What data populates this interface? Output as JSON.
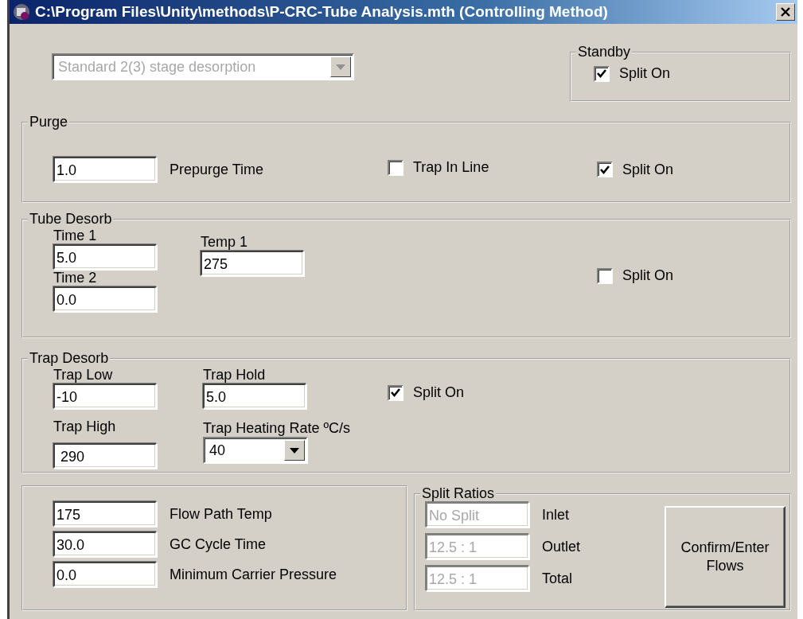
{
  "window": {
    "title": "C:\\Program Files\\Unity\\methods\\P-CRC-Tube Analysis.mth (Controlling Method)"
  },
  "method_type": {
    "value": "Standard 2(3) stage desorption",
    "disabled": true
  },
  "standby": {
    "title": "Standby",
    "checkbox": {
      "label": "Split On",
      "checked": true
    }
  },
  "purge": {
    "title": "Purge",
    "field": {
      "value": "1.0",
      "label": "Prepurge Time"
    },
    "checkboxes": [
      {
        "label": "Trap In Line",
        "checked": false
      },
      {
        "label": "Split On",
        "checked": true
      }
    ]
  },
  "tube_desorb": {
    "title": "Tube Desorb",
    "time_fields": [
      {
        "label": "Time 1",
        "value": "5.0"
      },
      {
        "label": "Time 2",
        "value": "0.0"
      }
    ],
    "temp_field": {
      "label": "Temp 1",
      "value": "275"
    },
    "checkbox": {
      "label": "Split On",
      "checked": false
    }
  },
  "trap_desorb": {
    "title": "Trap Desorb",
    "left_fields": [
      {
        "label": "Trap Low",
        "value": "-10"
      },
      {
        "label": "Trap High",
        "value": " 290"
      }
    ],
    "trap_hold": {
      "label": "Trap Hold",
      "value": "5.0"
    },
    "heating_rate": {
      "label": "Trap Heating Rate ºC/s",
      "value": "40",
      "disabled": false
    },
    "checkbox": {
      "label": "Split On",
      "checked": true
    }
  },
  "general": {
    "fields": [
      {
        "value": "175",
        "label": "Flow Path Temp"
      },
      {
        "value": "30.0",
        "label": "GC Cycle Time"
      },
      {
        "value": "0.0",
        "label": "Minimum Carrier Pressure"
      }
    ]
  },
  "split_ratios": {
    "title": "Split Ratios",
    "fields": [
      {
        "value": "No Split",
        "label": "Inlet",
        "disabled": true
      },
      {
        "value": "12.5 : 1",
        "label": "Outlet",
        "disabled": true
      },
      {
        "value": "12.5 : 1",
        "label": "Total",
        "disabled": true
      }
    ],
    "button": "Confirm/Enter Flows"
  }
}
